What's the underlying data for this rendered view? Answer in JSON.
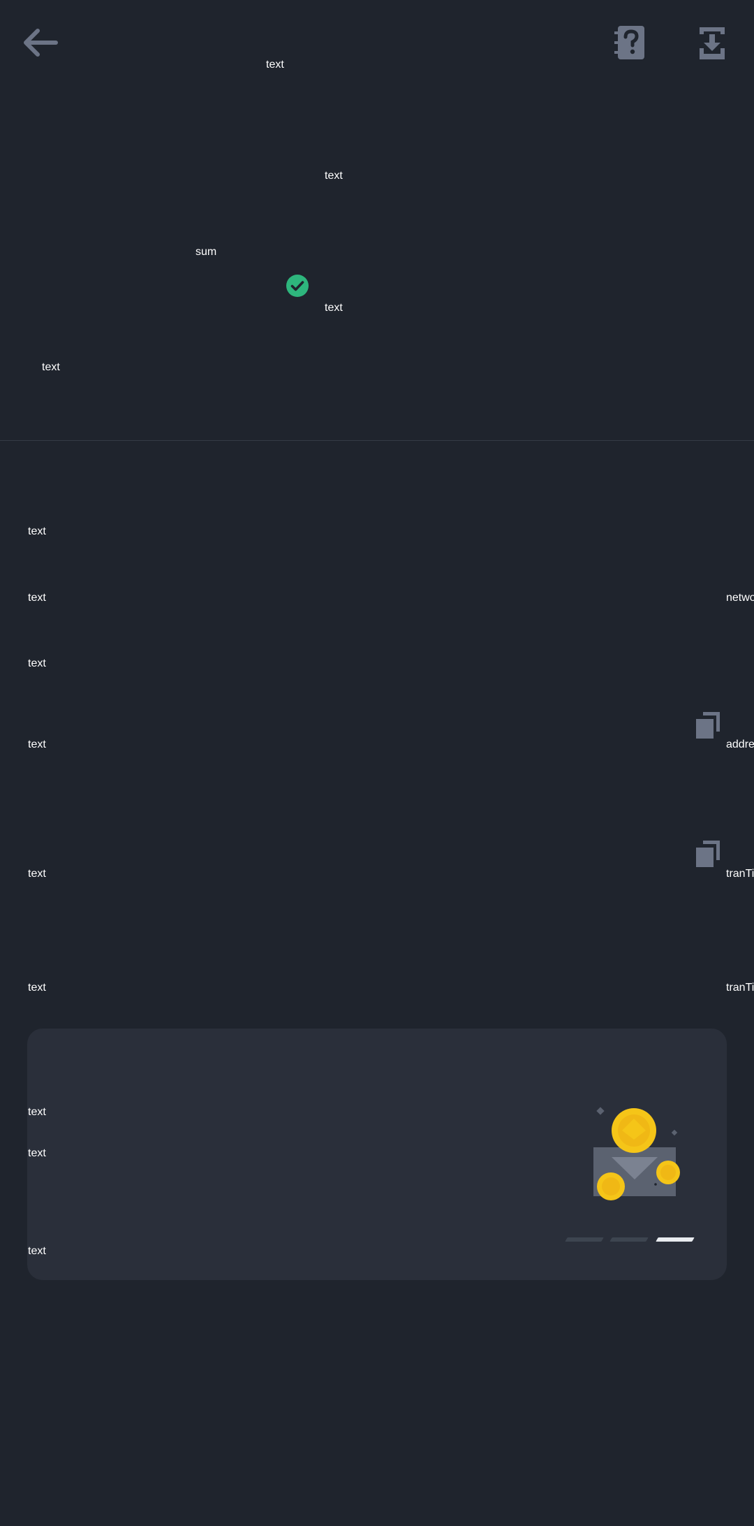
{
  "header": {
    "back_icon": "arrow-left-icon",
    "help_icon": "help-notebook-icon",
    "download_icon": "download-tray-icon",
    "title_text": "text"
  },
  "summary": {
    "text_line_1": "text",
    "sum_label": "sum",
    "status_icon": "check-circle-icon",
    "status_color": "#2eb67d",
    "status_text": "text",
    "text_line_3": "text"
  },
  "details": {
    "rows": [
      {
        "label": "text",
        "value": ""
      },
      {
        "label": "text",
        "value": "netwo"
      },
      {
        "label": "text",
        "value": ""
      },
      {
        "label": "text",
        "value": "addre",
        "copy_icon": "copy-icon"
      },
      {
        "label": "text",
        "value": "tranTi",
        "copy_icon": "copy-icon"
      },
      {
        "label": "text",
        "value": "tranTi"
      }
    ]
  },
  "promo": {
    "line_1": "text",
    "line_2": "text",
    "line_3": "text",
    "illustration": "coins-envelope-illustration",
    "pager": {
      "count": 3,
      "active": 3
    }
  },
  "colors": {
    "background": "#1f242d",
    "card": "#2a2f3a",
    "icon": "#6c7486",
    "coin": "#f5c518"
  }
}
